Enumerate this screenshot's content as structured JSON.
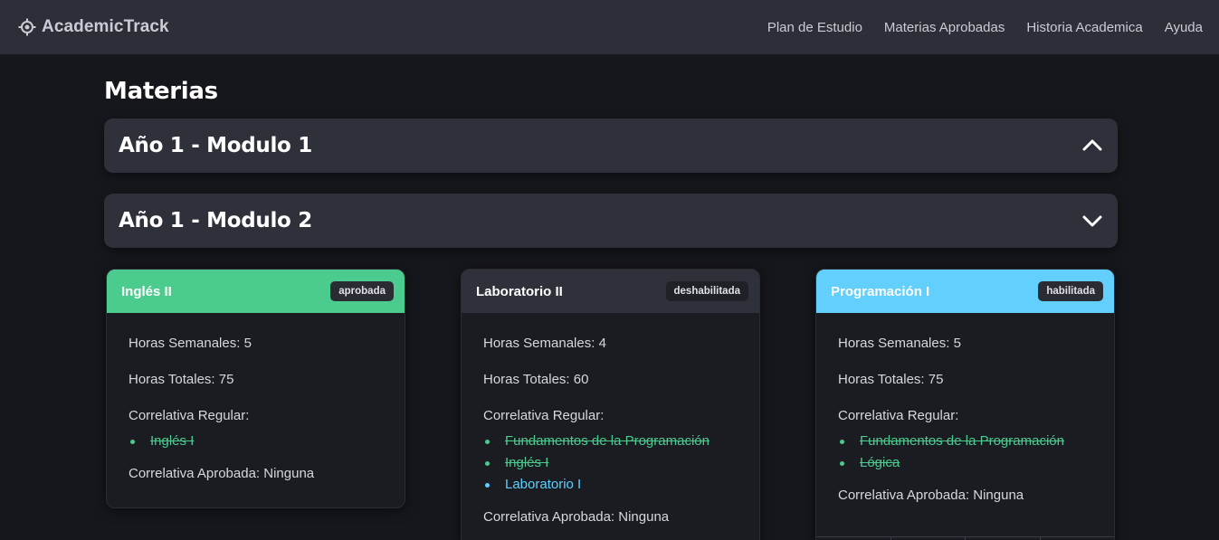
{
  "nav": {
    "brand": "AcademicTrack",
    "links": [
      "Plan de Estudio",
      "Materias Aprobadas",
      "Historia Academica",
      "Ayuda"
    ]
  },
  "main": {
    "title": "Materias",
    "accordions": [
      {
        "title": "Año 1 - Modulo 1",
        "expanded": false,
        "icon": "chevron-up-icon"
      },
      {
        "title": "Año 1 - Modulo 2",
        "expanded": true,
        "icon": "chevron-down-icon"
      }
    ]
  },
  "labels": {
    "horas_semanales": "Horas Semanales:",
    "horas_totales": "Horas Totales:",
    "correlativa_regular": "Correlativa Regular:",
    "correlativa_aprobada": "Correlativa Aprobada:"
  },
  "colors": {
    "aprobada": "#4ccb8e",
    "habilitada": "#63cffd",
    "deshabilitada": "#2e313a"
  },
  "cards": [
    {
      "title": "Inglés II",
      "status": "aprobada",
      "horas_semanales": "5",
      "horas_totales": "75",
      "correlativas_regular": [
        {
          "name": "Inglés I",
          "state": "aprobada"
        }
      ],
      "correlativa_aprobada": "Ninguna"
    },
    {
      "title": "Laboratorio II",
      "status": "deshabilitada",
      "horas_semanales": "4",
      "horas_totales": "60",
      "correlativas_regular": [
        {
          "name": "Fundamentos de la Programación",
          "state": "aprobada"
        },
        {
          "name": "Inglés I",
          "state": "aprobada"
        },
        {
          "name": "Laboratorio I",
          "state": "pendiente"
        }
      ],
      "correlativa_aprobada": "Ninguna"
    },
    {
      "title": "Programación I",
      "status": "habilitada",
      "horas_semanales": "5",
      "horas_totales": "75",
      "correlativas_regular": [
        {
          "name": "Fundamentos de la Programación",
          "state": "aprobada"
        },
        {
          "name": "Lógica",
          "state": "aprobada"
        }
      ],
      "correlativa_aprobada": "Ninguna"
    }
  ]
}
